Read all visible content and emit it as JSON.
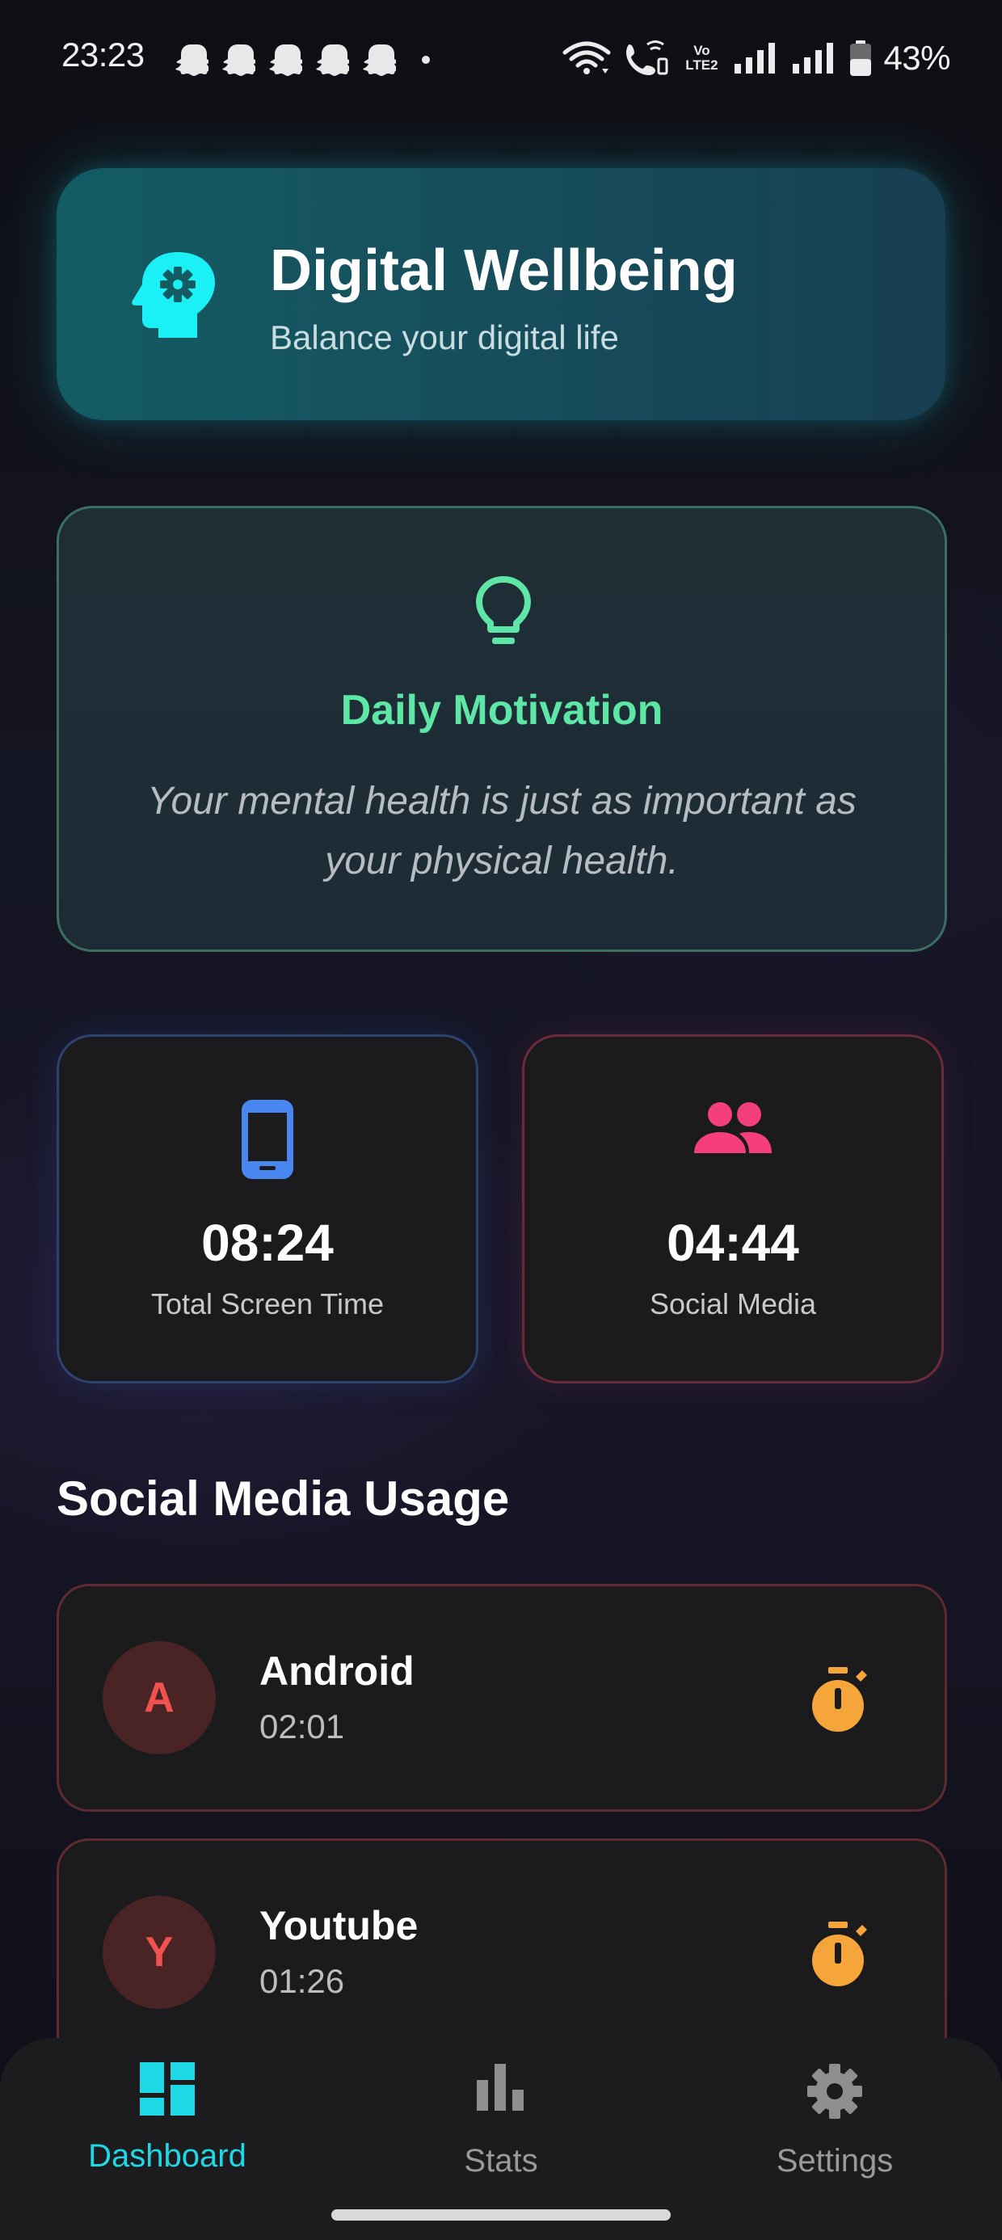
{
  "status_bar": {
    "time": "23:23",
    "battery_percent": "43%",
    "network_label_line1": "Vo",
    "network_label_line2": "LTE2"
  },
  "header": {
    "title": "Digital Wellbeing",
    "subtitle": "Balance your digital life",
    "icon": "psychology-head-gear-icon",
    "accent": "#19e3f0"
  },
  "motivation": {
    "title": "Daily Motivation",
    "quote": "Your mental health is just as important as your physical health.",
    "icon": "lightbulb-icon",
    "accent": "#5ee6a6"
  },
  "stats": {
    "screen_time": {
      "value": "08:24",
      "label": "Total Screen Time",
      "icon": "smartphone-icon",
      "accent": "#4a86f0"
    },
    "social_media": {
      "value": "04:44",
      "label": "Social Media",
      "icon": "group-people-icon",
      "accent": "#f43e7e"
    }
  },
  "usage": {
    "section_title": "Social Media Usage",
    "apps": [
      {
        "initial": "A",
        "name": "Android",
        "time": "02:01",
        "icon": "timer-icon"
      },
      {
        "initial": "Y",
        "name": "Youtube",
        "time": "01:26",
        "icon": "timer-icon"
      }
    ],
    "timer_color": "#f5a53a"
  },
  "nav": {
    "items": [
      {
        "label": "Dashboard",
        "icon": "dashboard-icon",
        "active": true
      },
      {
        "label": "Stats",
        "icon": "bar-chart-icon",
        "active": false
      },
      {
        "label": "Settings",
        "icon": "gear-icon",
        "active": false
      }
    ],
    "active_color": "#1fd8e6"
  }
}
